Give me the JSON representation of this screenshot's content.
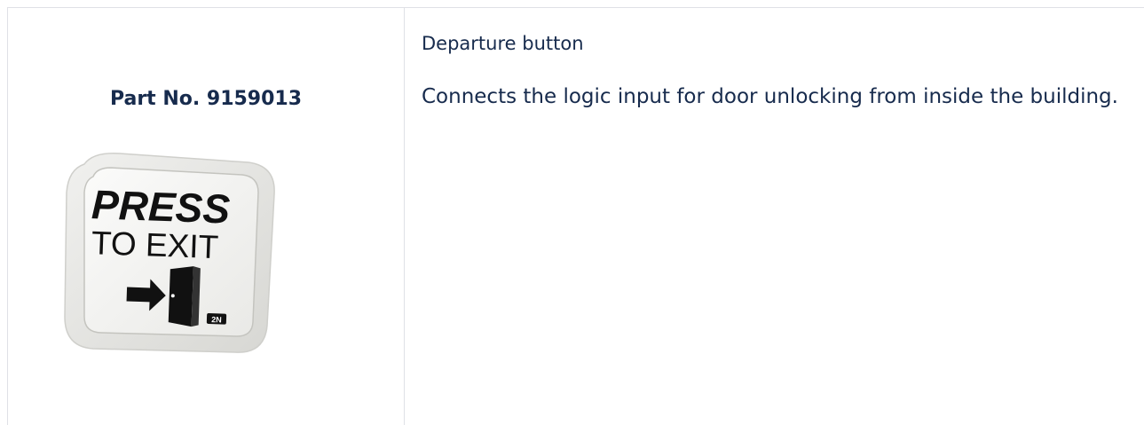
{
  "left_cell": {
    "part_number": "Part No. 9159013",
    "image": {
      "line1": "PRESS",
      "line2": "TO EXIT",
      "brand": "2N",
      "icon": "exit-door-arrow-icon"
    }
  },
  "right_cell": {
    "title": "Departure button",
    "description": "Connects the logic input for door unlocking from inside the building."
  }
}
